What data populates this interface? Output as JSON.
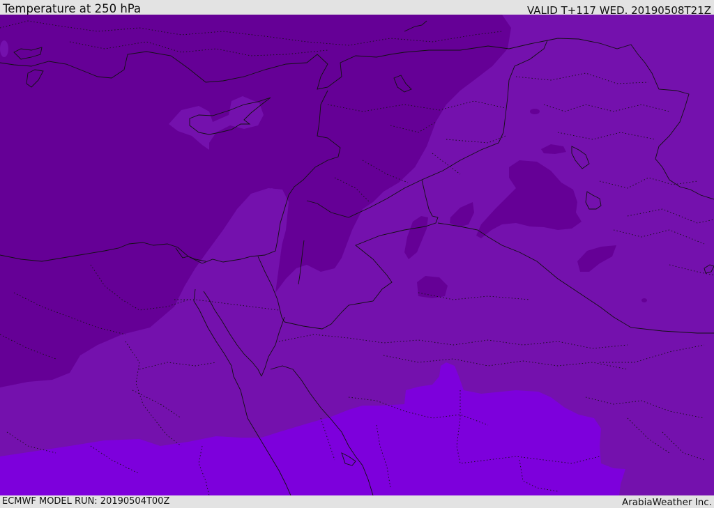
{
  "header": {
    "title": "Temperature at 250 hPa",
    "valid_time": "VALID T+117 WED. 20190508T21Z"
  },
  "footer": {
    "model_run": "ECMWF MODEL RUN: 20190504T00Z",
    "credit": "ArabiaWeather Inc."
  },
  "colors": {
    "band_coldest": "#650096",
    "band_cold": "#7411ad",
    "band_warm": "#7d00dc",
    "border_line": "#111111",
    "background": "#e3e3e3"
  },
  "map": {
    "region": "Eastern Mediterranean and Middle East",
    "bands": [
      "band-coldest",
      "band-cold",
      "band-warm"
    ]
  }
}
